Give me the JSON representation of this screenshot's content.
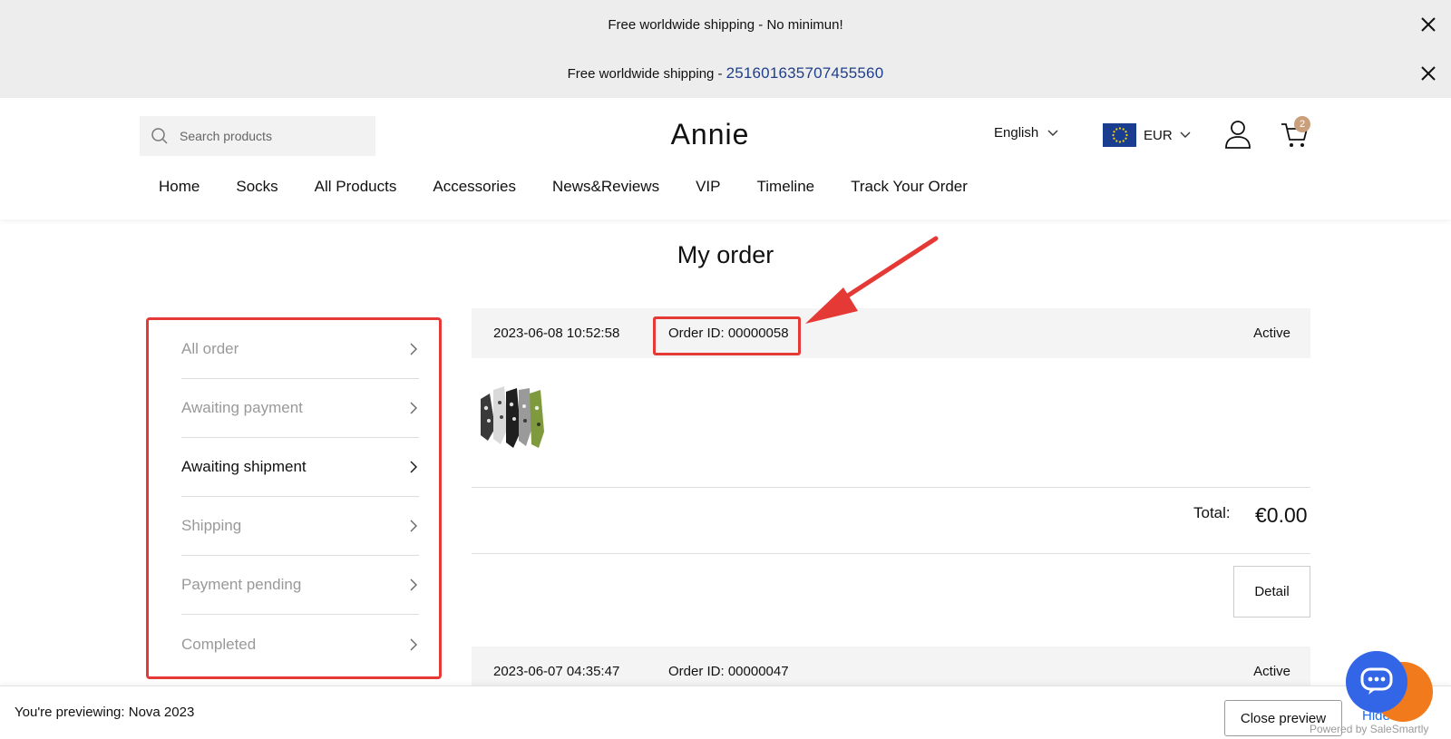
{
  "announcements": [
    {
      "text": "Free worldwide shipping - No minimun!",
      "tracking": ""
    },
    {
      "text": "Free worldwide shipping - ",
      "tracking": "251601635707455560"
    }
  ],
  "header": {
    "search_placeholder": "Search products",
    "logo": "Annie",
    "language": "English",
    "currency": "EUR",
    "cart_count": "2",
    "nav": [
      "Home",
      "Socks",
      "All Products",
      "Accessories",
      "News&Reviews",
      "VIP",
      "Timeline",
      "Track Your Order"
    ]
  },
  "page": {
    "title": "My order"
  },
  "sidebar": {
    "items": [
      {
        "label": "All order"
      },
      {
        "label": "Awaiting payment"
      },
      {
        "label": "Awaiting shipment"
      },
      {
        "label": "Shipping"
      },
      {
        "label": "Payment pending"
      },
      {
        "label": "Completed"
      }
    ]
  },
  "orders": [
    {
      "date": "2023-06-08 10:52:58",
      "order_id": "Order ID: 00000058",
      "status": "Active",
      "total_label": "Total:",
      "total": "€0.00",
      "detail_label": "Detail"
    },
    {
      "date": "2023-06-07 04:35:47",
      "order_id": "Order ID: 00000047",
      "status": "Active"
    }
  ],
  "preview_bar": {
    "prefix": "You're previewing: ",
    "theme": "Nova 2023",
    "close_label": "Close preview",
    "hide_label": "Hide",
    "powered_by": "Powered by SaleSmartly"
  },
  "colors": {
    "highlight": "#e53935",
    "accent_blue": "#3366e6",
    "badge": "#c9a07a"
  }
}
